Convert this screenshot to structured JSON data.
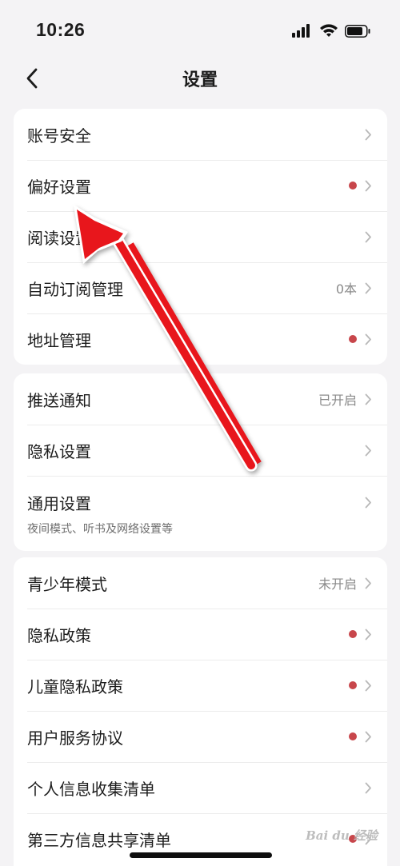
{
  "status_bar": {
    "time": "10:26"
  },
  "nav": {
    "title": "设置"
  },
  "groups": [
    {
      "rows": [
        {
          "label": "账号安全",
          "value": "",
          "dot": false
        },
        {
          "label": "偏好设置",
          "value": "",
          "dot": true
        },
        {
          "label": "阅读设置",
          "value": "",
          "dot": false
        },
        {
          "label": "自动订阅管理",
          "value": "0本",
          "dot": false
        },
        {
          "label": "地址管理",
          "value": "",
          "dot": true
        }
      ]
    },
    {
      "rows": [
        {
          "label": "推送通知",
          "value": "已开启",
          "dot": false
        },
        {
          "label": "隐私设置",
          "value": "",
          "dot": false
        },
        {
          "label": "通用设置",
          "value": "",
          "dot": false,
          "subtitle": "夜间模式、听书及网络设置等"
        }
      ]
    },
    {
      "rows": [
        {
          "label": "青少年模式",
          "value": "未开启",
          "dot": false
        },
        {
          "label": "隐私政策",
          "value": "",
          "dot": true
        },
        {
          "label": "儿童隐私政策",
          "value": "",
          "dot": true
        },
        {
          "label": "用户服务协议",
          "value": "",
          "dot": true
        },
        {
          "label": "个人信息收集清单",
          "value": "",
          "dot": false
        },
        {
          "label": "第三方信息共享清单",
          "value": "",
          "dot": true
        }
      ]
    }
  ],
  "watermark": {
    "text": "Bai du 经验"
  },
  "colors": {
    "background": "#f4f3f5",
    "card": "#ffffff",
    "badge_dot": "#c8464b",
    "arrow": "#e8141c"
  },
  "icons": [
    "signal-icon",
    "wifi-icon",
    "battery-icon",
    "back-chevron-icon",
    "chevron-right-icon",
    "annotation-arrow-icon"
  ]
}
